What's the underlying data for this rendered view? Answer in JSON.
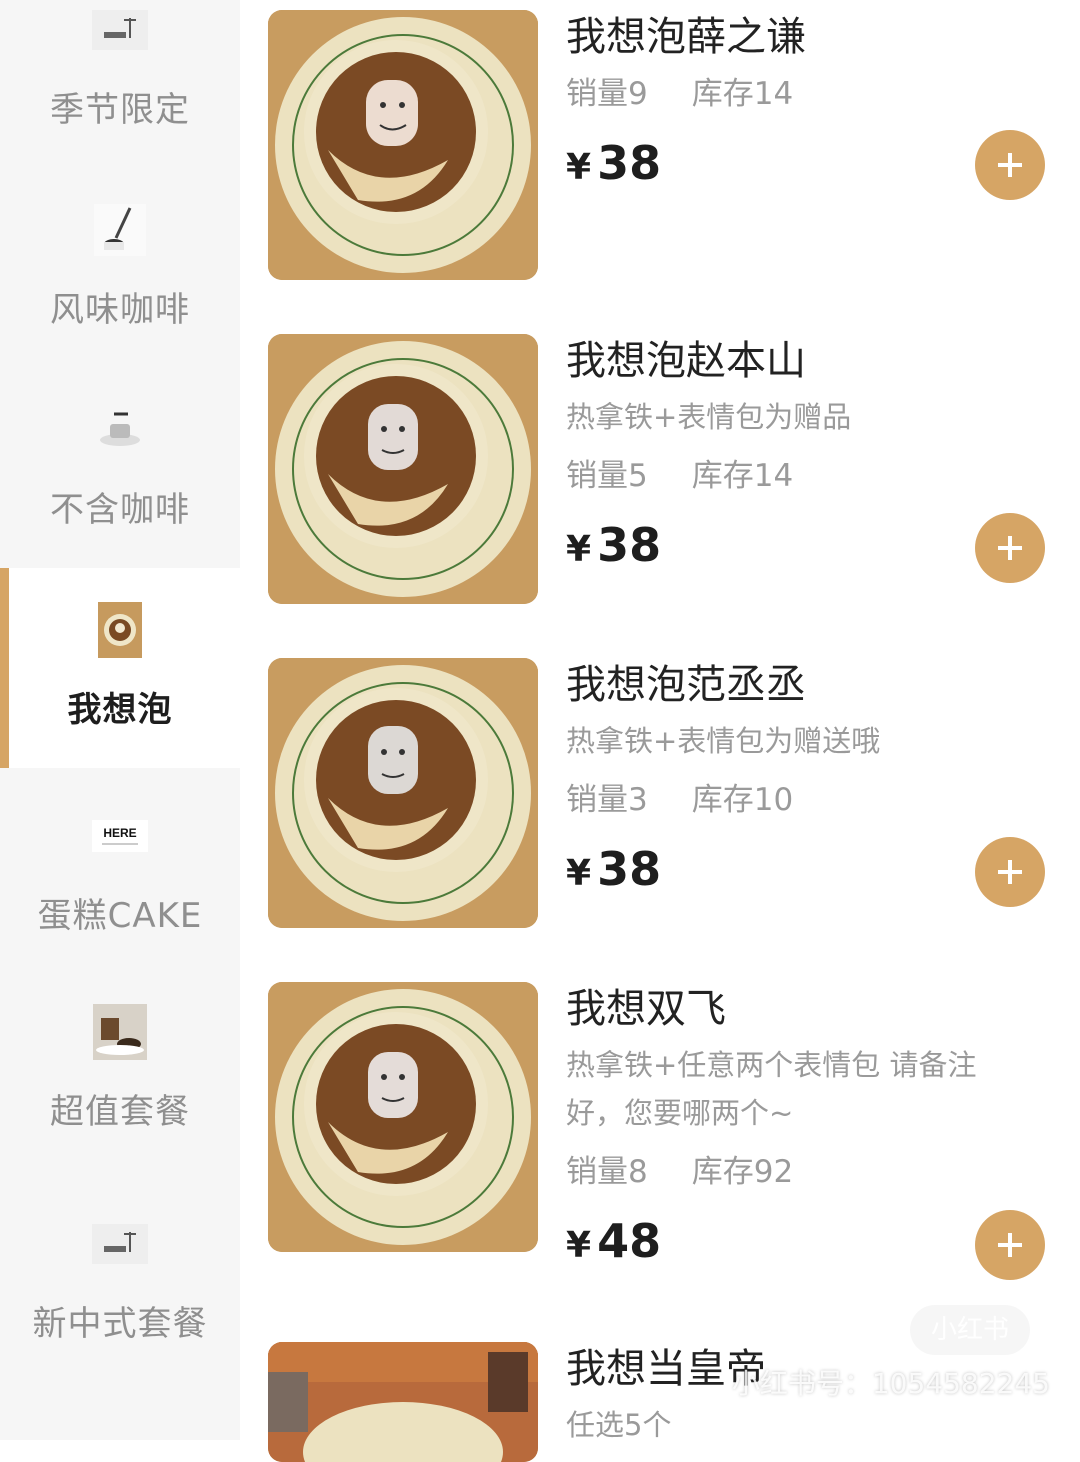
{
  "sidebar": {
    "items": [
      {
        "label": "季节限定",
        "icon": "cup-saucer-icon"
      },
      {
        "label": "风味咖啡",
        "icon": "coffee-pour-icon"
      },
      {
        "label": "不含咖啡",
        "icon": "teacup-icon"
      },
      {
        "label": "我想泡",
        "icon": "latte-art-icon",
        "active": true
      },
      {
        "label": "蛋糕CAKE",
        "icon": "here-logo-icon",
        "logo_text": "HERE"
      },
      {
        "label": "超值套餐",
        "icon": "coffee-set-icon"
      },
      {
        "label": "新中式套餐",
        "icon": "cup-saucer-icon"
      }
    ]
  },
  "products": [
    {
      "name": "我想泡薛之谦",
      "desc": "",
      "sales": "销量9",
      "stock": "库存14",
      "currency": "¥",
      "price": "38"
    },
    {
      "name": "我想泡赵本山",
      "desc": "热拿铁+表情包为赠品",
      "sales": "销量5",
      "stock": "库存14",
      "currency": "¥",
      "price": "38"
    },
    {
      "name": "我想泡范丞丞",
      "desc": "热拿铁+表情包为赠送哦",
      "sales": "销量3",
      "stock": "库存10",
      "currency": "¥",
      "price": "38"
    },
    {
      "name": "我想双飞",
      "desc_line1": "热拿铁+任意两个表情包 请备注",
      "desc_line2": "好，您要哪两个~",
      "sales": "销量8",
      "stock": "库存92",
      "currency": "¥",
      "price": "48"
    },
    {
      "name": "我想当皇帝",
      "desc": "任选5个"
    }
  ],
  "watermark": {
    "logo": "小红书",
    "text": "小红书号：1054582245"
  },
  "colors": {
    "accent": "#d6a565",
    "sidebar_bg": "#f6f6f6",
    "text_muted": "#9a9a9a"
  }
}
